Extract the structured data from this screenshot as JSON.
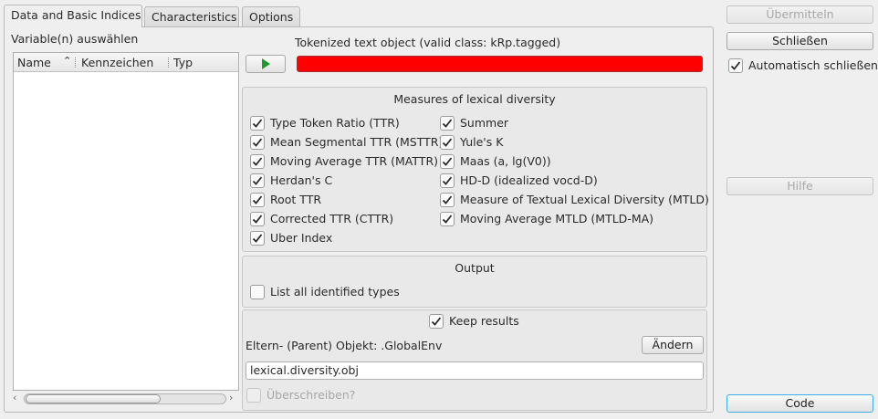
{
  "tabs": [
    {
      "label": "Data and Basic Indices",
      "active": true
    },
    {
      "label": "Characteristics",
      "active": false
    },
    {
      "label": "Options",
      "active": false
    }
  ],
  "variables": {
    "label": "Variable(n) auswählen",
    "columns": [
      "Name",
      "Kennzeichen",
      "Typ"
    ],
    "rows": []
  },
  "token": {
    "label": "Tokenized text object (valid class: kRp.tagged)",
    "progress_color": "#ff0000"
  },
  "measures": {
    "title": "Measures of lexical diversity",
    "left": [
      {
        "label": "Type Token Ratio (TTR)",
        "checked": true
      },
      {
        "label": "Mean Segmental TTR (MSTTR)",
        "checked": true
      },
      {
        "label": "Moving Average TTR (MATTR)",
        "checked": true
      },
      {
        "label": "Herdan's C",
        "checked": true
      },
      {
        "label": "Root TTR",
        "checked": true
      },
      {
        "label": "Corrected TTR (CTTR)",
        "checked": true
      },
      {
        "label": "Uber Index",
        "checked": true
      }
    ],
    "right": [
      {
        "label": "Summer",
        "checked": true
      },
      {
        "label": "Yule's K",
        "checked": true
      },
      {
        "label": "Maas (a, lg(V0))",
        "checked": true
      },
      {
        "label": "HD-D (idealized vocd-D)",
        "checked": true
      },
      {
        "label": "Measure of Textual Lexical Diversity (MTLD)",
        "checked": true
      },
      {
        "label": "Moving Average MTLD (MTLD-MA)",
        "checked": true
      }
    ]
  },
  "output": {
    "title": "Output",
    "list_types_label": "List all identified types",
    "list_types_checked": false
  },
  "save": {
    "keep_label": "Keep results",
    "keep_checked": true,
    "parent_label": "Eltern- (Parent) Objekt: .GlobalEnv",
    "change_label": "Ändern",
    "object_name": "lexical.diversity.obj",
    "overwrite_label": "Überschreiben?",
    "overwrite_checked": false
  },
  "side": {
    "submit_label": "Übermitteln",
    "close_label": "Schließen",
    "auto_close_label": "Automatisch schließen",
    "auto_close_checked": true,
    "help_label": "Hilfe",
    "code_label": "Code"
  }
}
